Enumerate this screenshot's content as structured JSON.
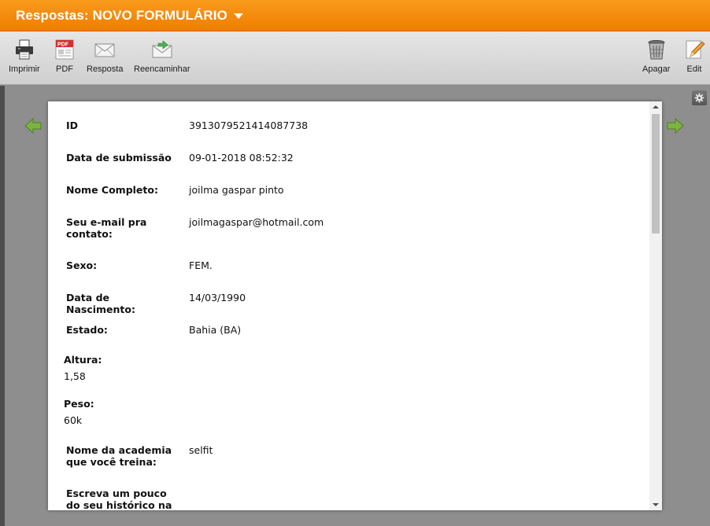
{
  "header": {
    "title": "Respostas: NOVO FORMULÁRIO"
  },
  "toolbar": {
    "print_label": "Imprimir",
    "pdf_label": "PDF",
    "reply_label": "Resposta",
    "forward_label": "Reencaminhar",
    "delete_label": "Apagar",
    "edit_label": "Edit",
    "pdf_icon_text": "PDF"
  },
  "submission": {
    "rows": [
      {
        "label": "ID",
        "value": "3913079521414087738"
      },
      {
        "label": "Data de submissão",
        "value": "09-01-2018 08:52:32"
      },
      {
        "label": "Nome Completo:",
        "value": "joilma gaspar pinto"
      },
      {
        "label": "Seu e-mail pra contato:",
        "value": "joilmagaspar@hotmail.com"
      },
      {
        "label": "Sexo:",
        "value": "FEM."
      },
      {
        "label": "Data de Nascimento:",
        "value": "14/03/1990"
      },
      {
        "label": "Estado:",
        "value": "Bahia (BA)"
      }
    ],
    "stacked": [
      {
        "label": "Altura:",
        "value": "1,58"
      },
      {
        "label": "Peso:",
        "value": "60k"
      }
    ],
    "rows2": [
      {
        "label": "Nome da academia que você treina:",
        "value": "selfit"
      },
      {
        "label": "Escreva um pouco do seu histórico na",
        "value": ""
      }
    ]
  },
  "colors": {
    "header_orange": "#f28705",
    "toolbar_gray": "#d9d9d9",
    "background_gray": "#8e8e8e",
    "arrow_green": "#7cb342"
  }
}
